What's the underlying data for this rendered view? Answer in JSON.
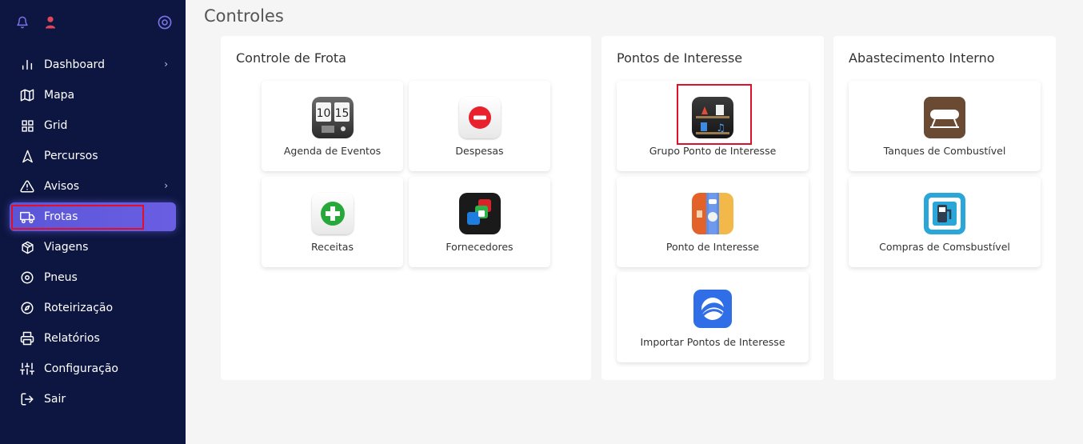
{
  "page": {
    "title": "Controles"
  },
  "sidebar": {
    "top_icons": [
      "bell-icon",
      "user-icon",
      "settings-circle-icon"
    ],
    "items": [
      {
        "label": "Dashboard",
        "icon": "bar-chart-icon",
        "has_submenu": true
      },
      {
        "label": "Mapa",
        "icon": "map-icon",
        "has_submenu": false
      },
      {
        "label": "Grid",
        "icon": "grid-icon",
        "has_submenu": false
      },
      {
        "label": "Percursos",
        "icon": "navigation-icon",
        "has_submenu": false
      },
      {
        "label": "Avisos",
        "icon": "warning-icon",
        "has_submenu": true
      },
      {
        "label": "Frotas",
        "icon": "truck-icon",
        "has_submenu": false,
        "active": true
      },
      {
        "label": "Viagens",
        "icon": "box-icon",
        "has_submenu": false
      },
      {
        "label": "Pneus",
        "icon": "tire-icon",
        "has_submenu": false
      },
      {
        "label": "Roteirização",
        "icon": "compass-icon",
        "has_submenu": false
      },
      {
        "label": "Relatórios",
        "icon": "printer-icon",
        "has_submenu": false
      },
      {
        "label": "Configuração",
        "icon": "sliders-icon",
        "has_submenu": false
      },
      {
        "label": "Sair",
        "icon": "logout-icon",
        "has_submenu": false
      }
    ]
  },
  "panels": {
    "frota": {
      "title": "Controle de Frota",
      "tiles": [
        {
          "label": "Agenda de Eventos",
          "icon": "flip-clock-icon"
        },
        {
          "label": "Despesas",
          "icon": "minus-circle-icon"
        },
        {
          "label": "Receitas",
          "icon": "plus-circle-icon"
        },
        {
          "label": "Fornecedores",
          "icon": "suppliers-icon"
        }
      ]
    },
    "pontos": {
      "title": "Pontos de Interesse",
      "tiles": [
        {
          "label": "Grupo Ponto de Interesse",
          "icon": "shelf-group-icon"
        },
        {
          "label": "Ponto de Interesse",
          "icon": "map-pin-icon"
        },
        {
          "label": "Importar Pontos de Interesse",
          "icon": "earth-import-icon"
        }
      ]
    },
    "abastecimento": {
      "title": "Abastecimento Interno",
      "tiles": [
        {
          "label": "Tanques de Combustível",
          "icon": "fuel-tank-icon"
        },
        {
          "label": "Compras de Comsbustível",
          "icon": "fuel-pump-icon"
        }
      ]
    }
  },
  "colors": {
    "sidebar_bg": "#0d1640",
    "active_item": "#5a56d8",
    "highlight_box": "#e0102a",
    "page_bg": "#f5f5f5"
  }
}
